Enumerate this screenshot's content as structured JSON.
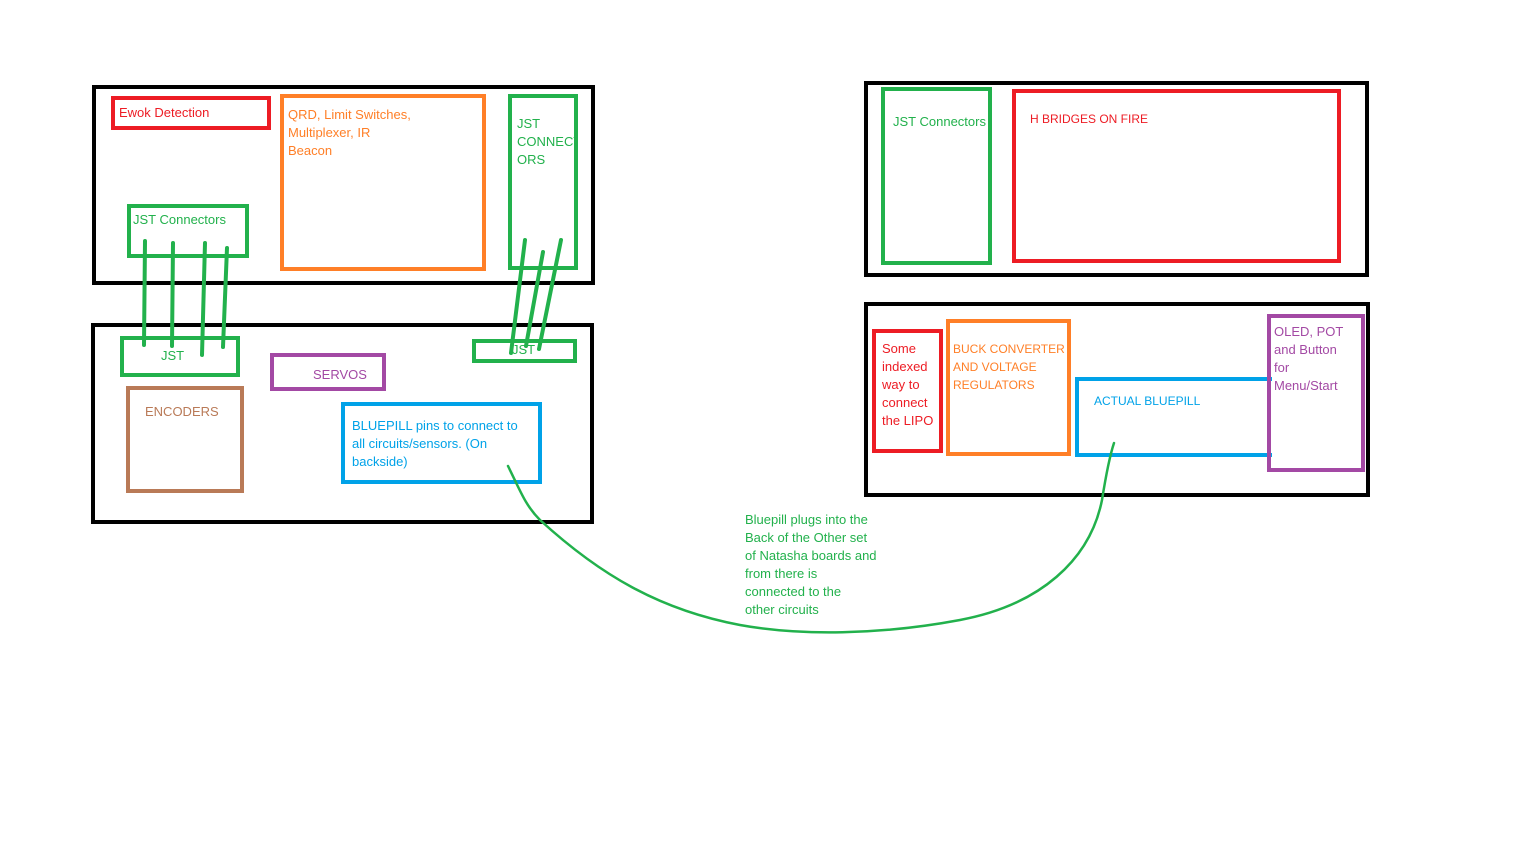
{
  "colors": {
    "board": "#000000",
    "red": "#ed1c24",
    "orange": "#ff7f27",
    "green": "#22b14c",
    "purple": "#a349a4",
    "blue": "#00a2e8",
    "brown": "#b97a57"
  },
  "top_left_board": {
    "ewok": "Ewok Detection",
    "qrd": "QRD, Limit Switches,\nMultiplexer, IR\nBeacon",
    "jst_right": "JST\nCONNECT\nORS",
    "jst_left": "JST Connectors"
  },
  "bottom_left_board": {
    "jst_left": "JST",
    "jst_right": "JST",
    "servos": "SERVOS",
    "encoders": "ENCODERS",
    "bluepill_pins": "BLUEPILL pins to connect to\nall circuits/sensors. (On\nbackside)"
  },
  "top_right_board": {
    "jst": "JST Connectors",
    "hbridges": "H BRIDGES ON FIRE"
  },
  "bottom_right_board": {
    "lipo": "Some\nindexed\nway to\nconnect\nthe LIPO",
    "buck": "BUCK CONVERTER\nAND VOLTAGE\nREGULATORS",
    "bluepill": "ACTUAL BLUEPILL",
    "oled": "OLED, POT\nand Button\nfor\nMenu/Start"
  },
  "annotation": "Bluepill plugs into the\nBack of the Other set\nof Natasha boards and\nfrom there is\nconnected to the\nother circuits"
}
